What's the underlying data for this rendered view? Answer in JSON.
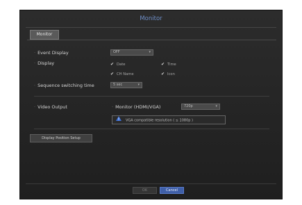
{
  "window": {
    "title": "Monitor"
  },
  "tabs": [
    {
      "label": "Monitor"
    }
  ],
  "event_display": {
    "label": "Event Display",
    "value": "OFF"
  },
  "display": {
    "label": "Display",
    "options": [
      {
        "label": "Date",
        "checked": true
      },
      {
        "label": "Time",
        "checked": true
      },
      {
        "label": "CH Name",
        "checked": true
      },
      {
        "label": "Icon",
        "checked": true
      }
    ]
  },
  "sequence": {
    "label": "Sequence switching time",
    "value": "5 sec"
  },
  "video_output": {
    "label": "Video Output",
    "monitor_label": "Monitor (HDMI/VGA)",
    "resolution_value": "720p",
    "note": "VGA compatible resolution ( ≤ 1080p )"
  },
  "display_position_button": "Display Position Setup",
  "footer": {
    "ok_label": "OK",
    "cancel_label": "Cancel"
  },
  "colors": {
    "title": "#6f8fc8",
    "cancel_bg": "#3f5fa8",
    "warning": "#3b6fd6"
  }
}
